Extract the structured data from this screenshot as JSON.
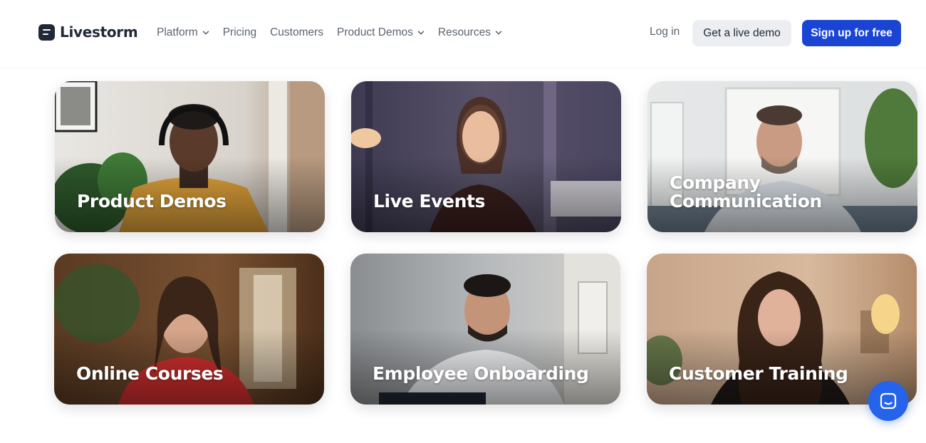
{
  "header": {
    "brand": "Livestorm",
    "nav": [
      {
        "label": "Platform",
        "has_dropdown": true
      },
      {
        "label": "Pricing",
        "has_dropdown": false
      },
      {
        "label": "Customers",
        "has_dropdown": false
      },
      {
        "label": "Product Demos",
        "has_dropdown": true
      },
      {
        "label": "Resources",
        "has_dropdown": true
      }
    ],
    "login_label": "Log in",
    "demo_label": "Get a live demo",
    "signup_label": "Sign up for free"
  },
  "cards": [
    {
      "label": "Product Demos"
    },
    {
      "label": "Live Events"
    },
    {
      "label": "Company Communication"
    },
    {
      "label": "Online Courses"
    },
    {
      "label": "Employee Onboarding"
    },
    {
      "label": "Customer Training"
    }
  ],
  "colors": {
    "brand_dark": "#1f2937",
    "primary": "#1a44d4",
    "chat": "#2563eb",
    "secondary_button": "#eceef2"
  },
  "chat_widget": {
    "icon": "chat-icon"
  }
}
